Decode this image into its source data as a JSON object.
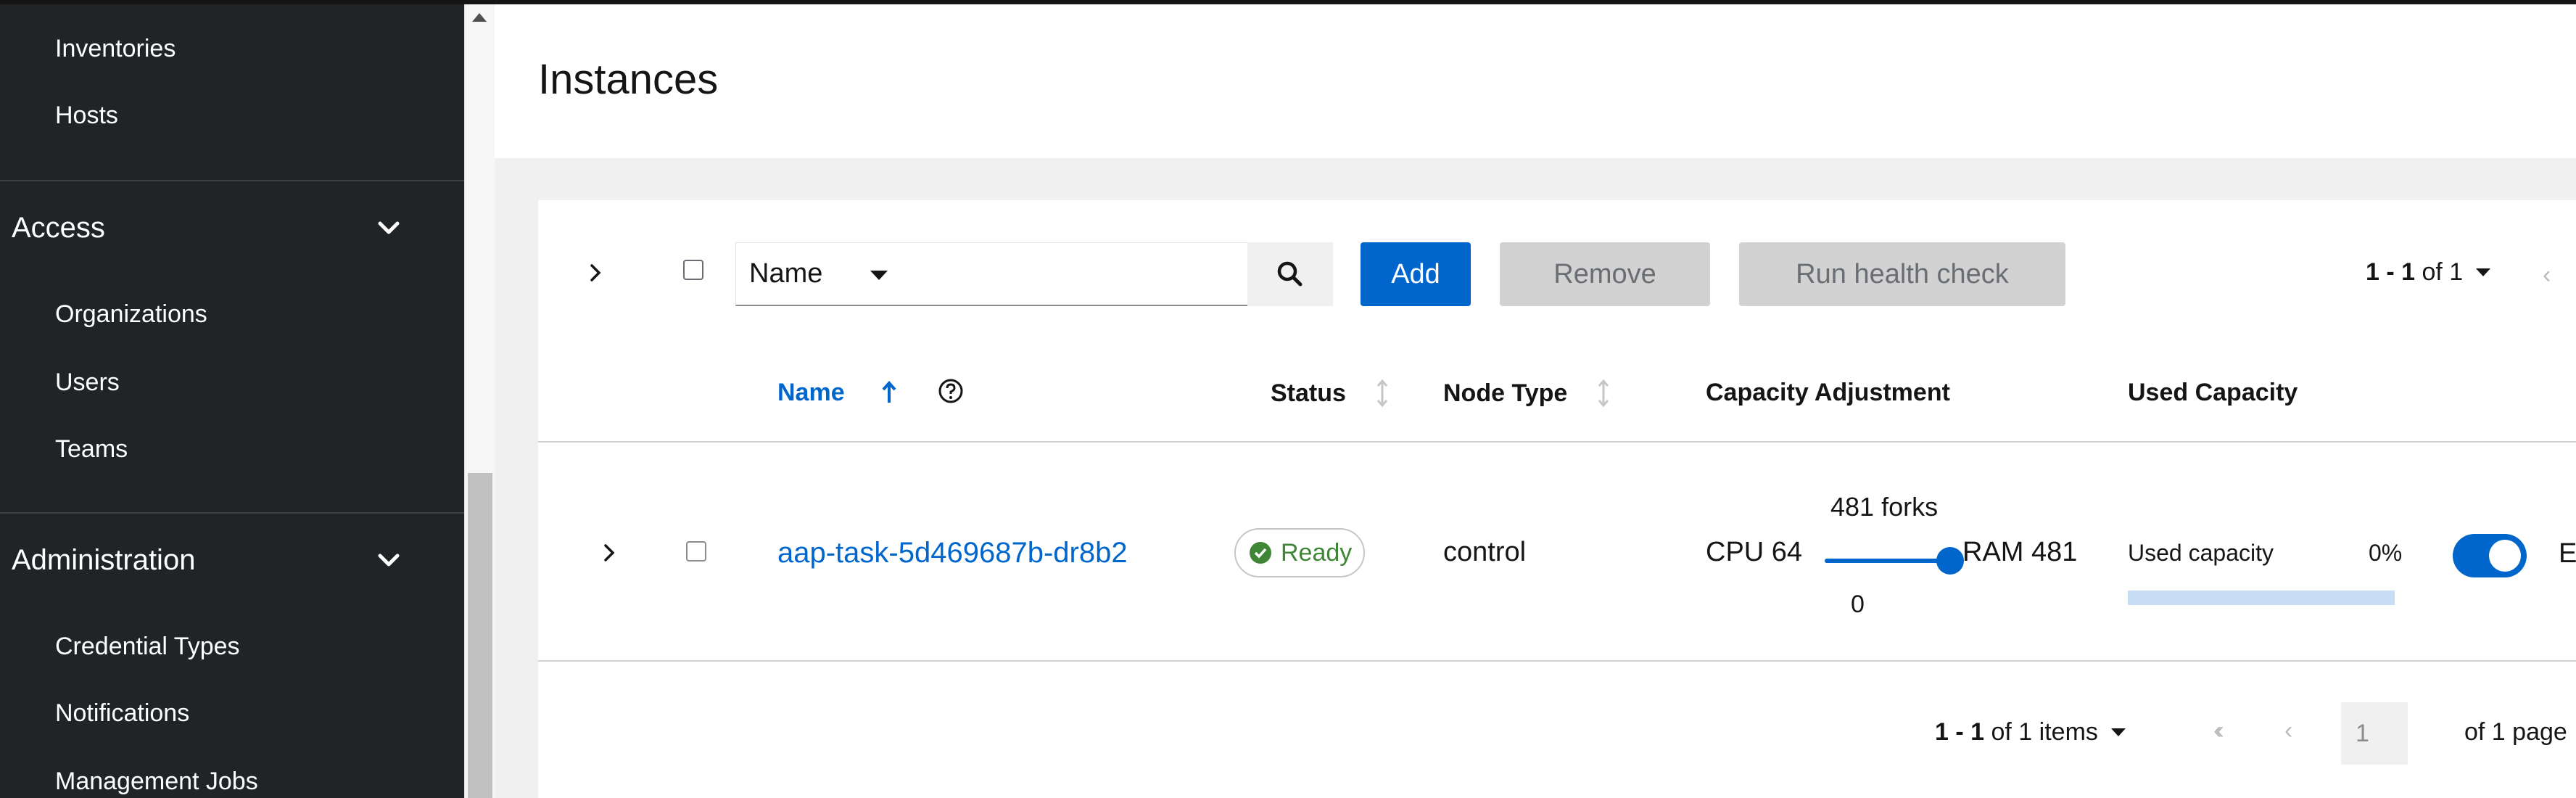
{
  "sidebar": {
    "top_items": [
      "Inventories",
      "Hosts"
    ],
    "access": {
      "label": "Access",
      "items": [
        "Organizations",
        "Users",
        "Teams"
      ]
    },
    "administration": {
      "label": "Administration",
      "items": [
        "Credential Types",
        "Notifications",
        "Management Jobs"
      ]
    }
  },
  "page": {
    "title": "Instances"
  },
  "toolbar": {
    "filter_field": "Name",
    "search_value": "",
    "add_label": "Add",
    "remove_label": "Remove",
    "health_label": "Run health check",
    "pagination_range": "1 - 1",
    "pagination_of": "of 1"
  },
  "table": {
    "columns": {
      "name": "Name",
      "status": "Status",
      "node_type": "Node Type",
      "capacity_adjustment": "Capacity Adjustment",
      "used_capacity": "Used Capacity"
    },
    "rows": [
      {
        "name": "aap-task-5d469687b-dr8b2",
        "status": "Ready",
        "node_type": "control",
        "forks": "481 forks",
        "cpu": "CPU 64",
        "ram": "RAM 481",
        "slider_min_label": "0",
        "slider_value_fraction": 1.0,
        "used_capacity_label": "Used capacity",
        "used_capacity_pct": "0%",
        "used_capacity_fraction": 0,
        "enabled": true,
        "enabled_label_clip": "E"
      }
    ]
  },
  "footer_pagination": {
    "range": "1 - 1",
    "items_suffix": "of 1 items",
    "current_page": "1",
    "of_pages": "of 1 page"
  },
  "colors": {
    "accent": "#0066cc",
    "sidebar_bg": "#212427",
    "ready_green": "#3e8635"
  }
}
